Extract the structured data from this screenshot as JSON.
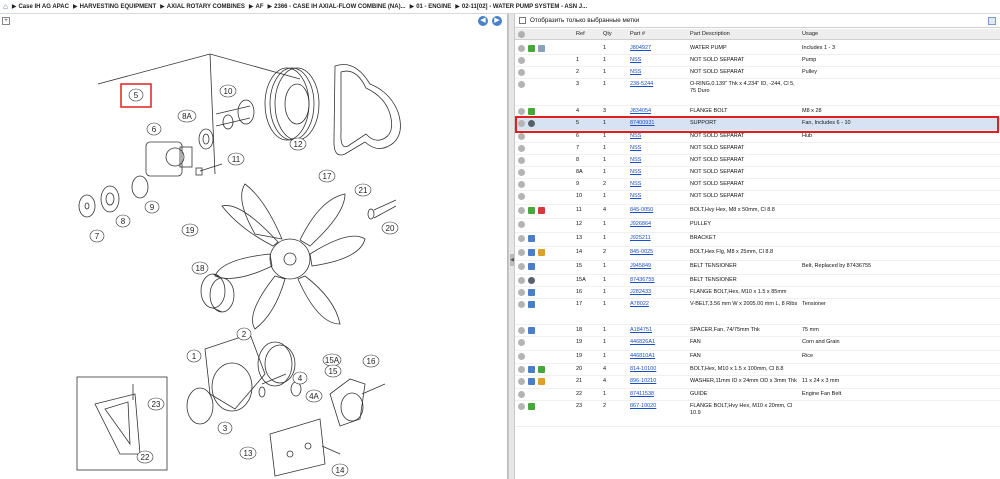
{
  "breadcrumb": [
    "Case IH AG APAC",
    "HARVESTING EQUIPMENT",
    "AXIAL ROTARY COMBINES",
    "AF",
    "2366 - CASE IH AXIAL-FLOW COMBINE (NA)...",
    "01 - ENGINE",
    "02-11[02] - WATER PUMP SYSTEM - ASN J..."
  ],
  "filter": {
    "label": "Отобразить только выбранные метки"
  },
  "columns": {
    "ref": "Ref",
    "qty": "Qty",
    "part": "Part #",
    "desc": "Part Description",
    "usage": "Usage"
  },
  "callouts": [
    "10",
    "8A",
    "6",
    "11",
    "12",
    "17",
    "5",
    "9",
    "8",
    "7",
    "21",
    "20",
    "19",
    "18",
    "2",
    "1",
    "3",
    "15A",
    "15",
    "16",
    "4",
    "4A",
    "13",
    "14",
    "23",
    "22"
  ],
  "rows": [
    {
      "ref": "",
      "qty": "1",
      "part": "J804927",
      "desc": "WATER PUMP",
      "usage": "Includes 1 - 3",
      "icons": [
        "gray",
        "green",
        "tool"
      ]
    },
    {
      "ref": "1",
      "qty": "1",
      "part": "NSS",
      "desc": "NOT SOLD SEPARAT",
      "usage": "Pump",
      "icons": [
        "gray"
      ]
    },
    {
      "ref": "2",
      "qty": "1",
      "part": "NSS",
      "desc": "NOT SOLD SEPARAT",
      "usage": "Pulley",
      "icons": [
        "gray"
      ]
    },
    {
      "ref": "3",
      "qty": "1",
      "part": "238-5244",
      "desc": "O-RING,0.139\" Thk x 4.234\" ID, -244, Cl 5, 75 Duro",
      "usage": "",
      "icons": [
        "gray"
      ]
    },
    {
      "ref": "4",
      "qty": "3",
      "part": "J834054",
      "desc": "FLANGE BOLT",
      "usage": "M8 x 28",
      "icons": [
        "gray",
        "green"
      ]
    },
    {
      "ref": "5",
      "qty": "1",
      "part": "87400931",
      "desc": "SUPPORT",
      "usage": "Fan, Includes 6 - 10",
      "icons": [
        "gray",
        "dark"
      ]
    },
    {
      "ref": "6",
      "qty": "1",
      "part": "NSS",
      "desc": "NOT SOLD SEPARAT",
      "usage": "Hub",
      "icons": [
        "gray"
      ]
    },
    {
      "ref": "7",
      "qty": "1",
      "part": "NSS",
      "desc": "NOT SOLD SEPARAT",
      "usage": "",
      "icons": [
        "gray"
      ]
    },
    {
      "ref": "8",
      "qty": "1",
      "part": "NSS",
      "desc": "NOT SOLD SEPARAT",
      "usage": "",
      "icons": [
        "gray"
      ]
    },
    {
      "ref": "8A",
      "qty": "1",
      "part": "NSS",
      "desc": "NOT SOLD SEPARAT",
      "usage": "",
      "icons": [
        "gray"
      ]
    },
    {
      "ref": "9",
      "qty": "2",
      "part": "NSS",
      "desc": "NOT SOLD SEPARAT",
      "usage": "",
      "icons": [
        "gray"
      ]
    },
    {
      "ref": "10",
      "qty": "1",
      "part": "NSS",
      "desc": "NOT SOLD SEPARAT",
      "usage": "",
      "icons": [
        "gray"
      ]
    },
    {
      "ref": "11",
      "qty": "4",
      "part": "845-0050",
      "desc": "BOLT,Hvy Hex, M8 x 50mm, Cl 8.8",
      "usage": "",
      "icons": [
        "gray",
        "green",
        "red"
      ]
    },
    {
      "ref": "12",
      "qty": "1",
      "part": "J926864",
      "desc": "PULLEY",
      "usage": "",
      "icons": [
        "gray"
      ]
    },
    {
      "ref": "13",
      "qty": "1",
      "part": "J925211",
      "desc": "BRACKET",
      "usage": "",
      "icons": [
        "gray",
        "blue"
      ]
    },
    {
      "ref": "14",
      "qty": "2",
      "part": "845-0025",
      "desc": "BOLT,Hex Flg, M8 x 25mm, Cl 8.8",
      "usage": "",
      "icons": [
        "gray",
        "blue",
        "orange"
      ]
    },
    {
      "ref": "15",
      "qty": "1",
      "part": "J945849",
      "desc": "BELT TENSIONER",
      "usage": "Belt, Replaced by 87436755",
      "icons": [
        "gray",
        "blue"
      ]
    },
    {
      "ref": "15A",
      "qty": "1",
      "part": "87436755",
      "desc": "BELT TENSIONER",
      "usage": "",
      "icons": [
        "gray",
        "dark"
      ]
    },
    {
      "ref": "16",
      "qty": "1",
      "part": "J282433",
      "desc": "FLANGE BOLT,Hex, M10 x 1.5 x 85mm",
      "usage": "",
      "icons": [
        "gray",
        "blue"
      ]
    },
    {
      "ref": "17",
      "qty": "1",
      "part": "A78022",
      "desc": "V-BELT,3.56 mm W x 2005.00 mm L, 8 Ribs",
      "usage": "Tensioner",
      "icons": [
        "gray",
        "blue"
      ]
    },
    {
      "ref": "18",
      "qty": "1",
      "part": "A184751",
      "desc": "SPACER,Fan, 74/75mm Thk",
      "usage": "75 mm",
      "icons": [
        "gray",
        "blue"
      ]
    },
    {
      "ref": "19",
      "qty": "1",
      "part": "446826A1",
      "desc": "FAN",
      "usage": "Corn and Grain",
      "icons": [
        "gray"
      ]
    },
    {
      "ref": "19",
      "qty": "1",
      "part": "446810A1",
      "desc": "FAN",
      "usage": "Rice",
      "icons": [
        "gray"
      ]
    },
    {
      "ref": "20",
      "qty": "4",
      "part": "814-10100",
      "desc": "BOLT,Hex, M10 x 1.5 x 100mm, Cl 8.8",
      "usage": "",
      "icons": [
        "gray",
        "blue",
        "green"
      ]
    },
    {
      "ref": "21",
      "qty": "4",
      "part": "896-10210",
      "desc": "WASHER,11mm ID x 24mm OD x 3mm Thk",
      "usage": "11 x 24 x 3 mm",
      "icons": [
        "gray",
        "blue",
        "orange"
      ]
    },
    {
      "ref": "22",
      "qty": "1",
      "part": "87411538",
      "desc": "GUIDE",
      "usage": "Engine Fan Belt",
      "icons": [
        "gray"
      ]
    },
    {
      "ref": "23",
      "qty": "2",
      "part": "867-10020",
      "desc": "FLANGE BOLT,Hvy Hex, M10 x 20mm, Cl 10.9",
      "usage": "",
      "icons": [
        "gray",
        "green"
      ]
    }
  ],
  "colors": {
    "selected_row": "#d7e3f3",
    "highlight": "#e02020",
    "link": "#1a4fc8"
  }
}
